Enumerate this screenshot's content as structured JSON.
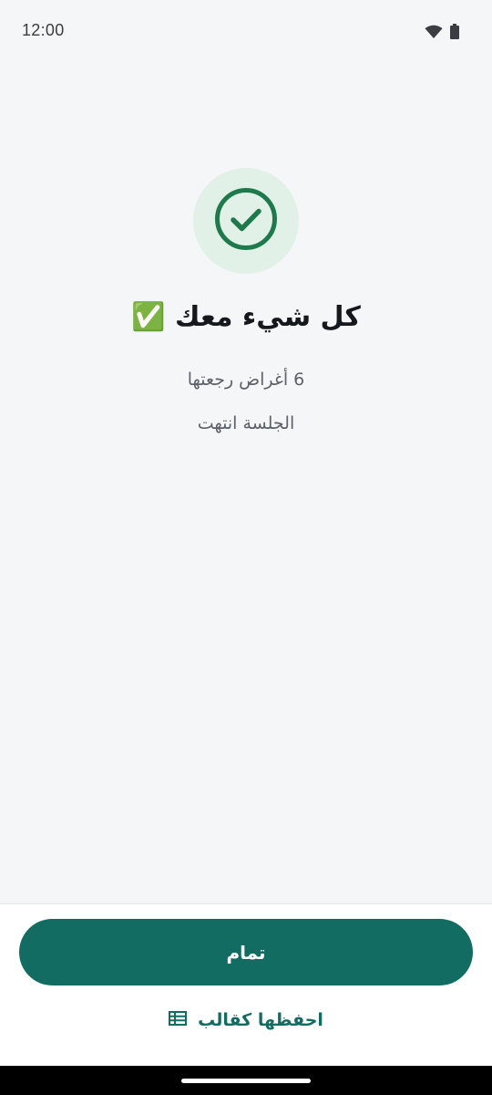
{
  "status_bar": {
    "time": "12:00",
    "icons": [
      "wifi-icon",
      "battery-icon"
    ]
  },
  "success": {
    "icon": "check-circle-icon",
    "title": "كل شيء معك ✅",
    "items_returned": "6 أغراض رجعتها",
    "session_status": "الجلسة انتهت"
  },
  "actions": {
    "done_label": "تمام",
    "save_template_label": "احفظها كقالب",
    "save_template_icon": "table-icon"
  },
  "colors": {
    "accent": "#126c62",
    "success_icon": "#1e7a4c",
    "success_bg": "#e1f1e7",
    "background": "#f5f6f8"
  }
}
